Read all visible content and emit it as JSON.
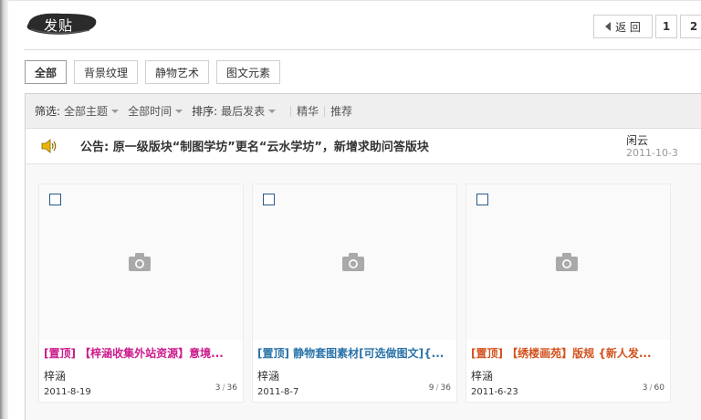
{
  "header": {
    "post_label": "发贴"
  },
  "pager": {
    "back_label": "返 回",
    "pages": [
      "1",
      "2"
    ]
  },
  "tabs": [
    "全部",
    "背景纹理",
    "静物艺术",
    "图文元素"
  ],
  "filter": {
    "filter_label": "筛选:",
    "theme": "全部主题",
    "time": "全部时间",
    "sort_label": "排序:",
    "sort_value": "最后发表",
    "digest": "精华",
    "recommend": "推荐"
  },
  "notice": {
    "icon": "speaker-icon",
    "title": "公告: 原一级版块“制图学坊”更名“云水学坊”，新增求助问答版块",
    "author": "闲云",
    "date": "2011-10-3"
  },
  "threads": [
    {
      "title": "[置顶] 【梓涵收集外站资源】意境...",
      "title_color": "#cc1a8c",
      "author": "梓涵",
      "date": "2011-8-19",
      "replies": "3",
      "views": "36"
    },
    {
      "title": "[置顶] 静物套图素材[可选做图文]{...",
      "title_color": "#2a73a8",
      "author": "梓涵",
      "date": "2011-8-7",
      "replies": "9",
      "views": "36"
    },
    {
      "title": "[置顶] 【绣楼画苑】版规 {新人发...",
      "title_color": "#d2521e",
      "author": "梓涵",
      "date": "2011-6-23",
      "replies": "3",
      "views": "60"
    }
  ]
}
